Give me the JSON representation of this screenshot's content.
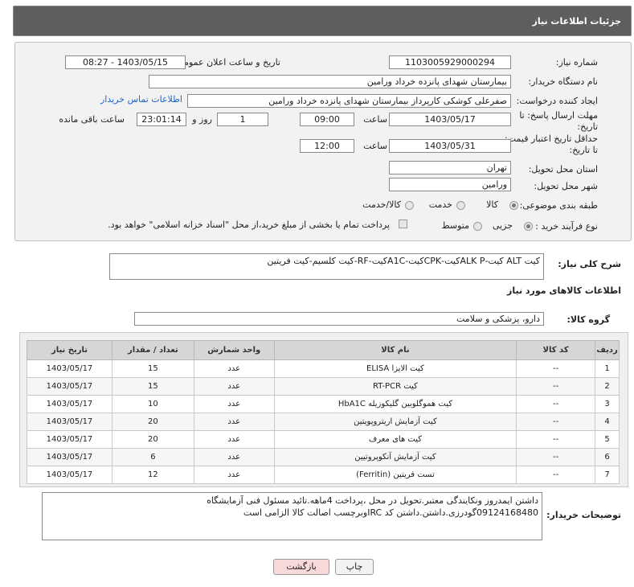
{
  "header": {
    "title": "جزئیات اطلاعات نیاز"
  },
  "form": {
    "need_number_label": "شماره نیاز:",
    "need_number": "1103005929000294",
    "announce_label": "تاریخ و ساعت اعلان عمومی:",
    "announce_value": "1403/05/15 - 08:27",
    "buyer_org_label": "نام دستگاه خریدار:",
    "buyer_org": "بیمارستان شهدای پانزده خرداد ورامین",
    "creator_label": "ایجاد کننده درخواست:",
    "creator": "صفرعلی کوشکی کارپرداز بیمارستان شهدای پانزده خرداد ورامین",
    "contact_link": "اطلاعات تماس خریدار",
    "send_deadline_label": "مهلت ارسال پاسخ: تا تاریخ:",
    "send_deadline_date": "1403/05/17",
    "time_label": "ساعت",
    "send_deadline_time": "09:00",
    "days_count": "1",
    "days_label": "روز و",
    "remaining_time": "23:01:14",
    "remaining_label": "ساعت باقی مانده",
    "price_deadline_label": "حداقل تاریخ اعتبار قیمت: تا تاریخ:",
    "price_deadline_date": "1403/05/31",
    "price_deadline_time": "12:00",
    "province_label": "استان محل تحویل:",
    "province": "تهران",
    "city_label": "شهر محل تحویل:",
    "city": "ورامین",
    "category_label": "طبقه بندی موضوعی:",
    "category_options": [
      "کالا",
      "خدمت",
      "کالا/خدمت"
    ],
    "process_label": "نوع فرآیند خرید :",
    "process_options": [
      "جزیی",
      "متوسط"
    ],
    "payment_note": "پرداخت تمام یا بخشی از مبلغ خرید،از محل \"اسناد خزانه اسلامی\" خواهد بود."
  },
  "summary": {
    "label": "شرح کلی نیاز:",
    "value": "کیت ALT کیت-ALK Pکیت-CPKکیت-A1Cکیت-RF-کیت کلسیم-کیت فریتین"
  },
  "goods": {
    "section_title": "اطلاعات کالاهای مورد نیاز",
    "group_label": "گروه کالا:",
    "group_value": "دارو، پزشکی و سلامت",
    "columns": [
      "ردیف",
      "کد کالا",
      "نام کالا",
      "واحد شمارش",
      "تعداد / مقدار",
      "تاریخ نیاز"
    ],
    "rows": [
      [
        "1",
        "--",
        "کیت الایزا ELISA",
        "عدد",
        "15",
        "1403/05/17"
      ],
      [
        "2",
        "--",
        "کیت RT-PCR",
        "عدد",
        "15",
        "1403/05/17"
      ],
      [
        "3",
        "--",
        "کیت هموگلوبین گلیکوزیله HbA1C",
        "عدد",
        "10",
        "1403/05/17"
      ],
      [
        "4",
        "--",
        "کیت آزمایش اریتروپویتین",
        "عدد",
        "20",
        "1403/05/17"
      ],
      [
        "5",
        "--",
        "کیت های معرف",
        "عدد",
        "20",
        "1403/05/17"
      ],
      [
        "6",
        "--",
        "کیت آزمایش آنکوپروتیین",
        "عدد",
        "6",
        "1403/05/17"
      ],
      [
        "7",
        "--",
        "تست فریتین (Ferritin)",
        "عدد",
        "12",
        "1403/05/17"
      ]
    ]
  },
  "notes": {
    "label": "توضیحات خریدار:",
    "line1": "داشتن ایمدروز ونکایندگی معتبر.تحویل در محل ،پرداخت 4ماهه.تائید مسئول فنی آزمایشگاه",
    "line2": "09124168480گودرزی.داشتن.داشتن کد IRCوبرچسب اصالت کالا الزامی است"
  },
  "buttons": {
    "print": "چاپ",
    "back": "بازگشت"
  },
  "colors": {
    "header_bg": "#5e5e5e",
    "link": "#1a66c8",
    "back_button_bg": "#f9dada"
  }
}
